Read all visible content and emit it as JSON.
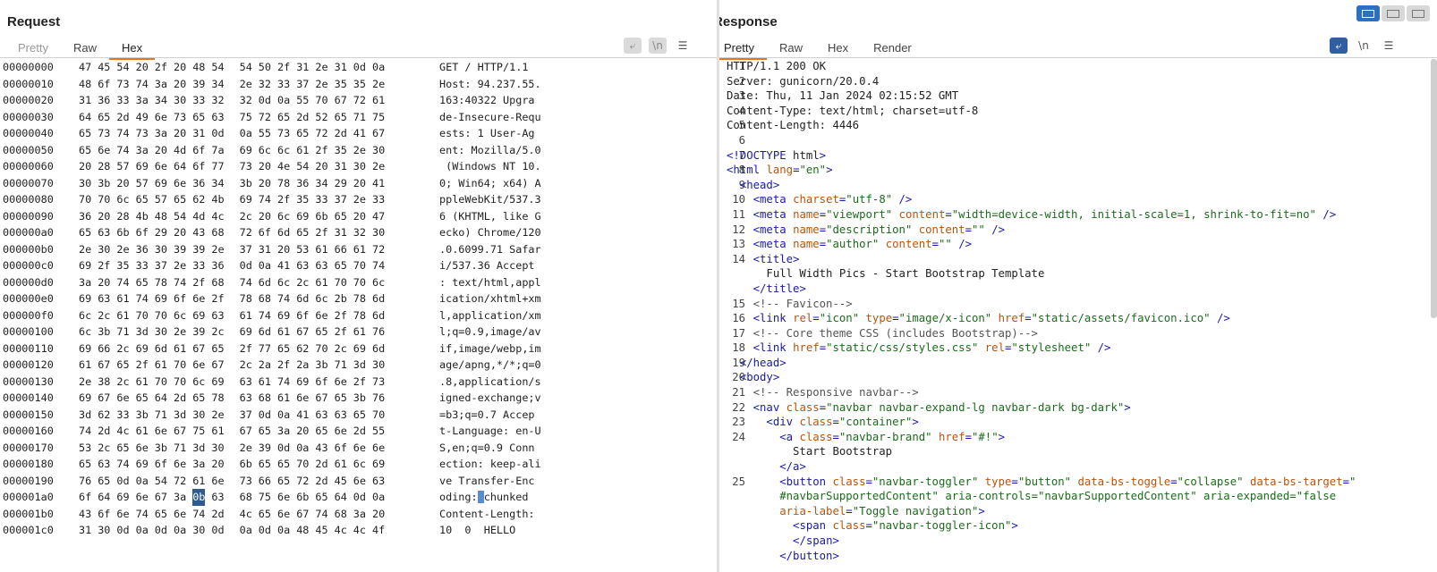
{
  "request": {
    "title": "Request",
    "tabs": [
      "Pretty",
      "Raw",
      "Hex"
    ],
    "active_tab": "Hex",
    "tools": {
      "wrap_icon": "wrap-icon",
      "newline": "\\n",
      "menu": "☰"
    },
    "rows": [
      {
        "offset": "00000000",
        "bytes": [
          "47",
          "45",
          "54",
          "20",
          "2f",
          "20",
          "48",
          "54",
          "54",
          "50",
          "2f",
          "31",
          "2e",
          "31",
          "0d",
          "0a"
        ],
        "ascii": "GET / HTTP/1.1"
      },
      {
        "offset": "00000010",
        "bytes": [
          "48",
          "6f",
          "73",
          "74",
          "3a",
          "20",
          "39",
          "34",
          "2e",
          "32",
          "33",
          "37",
          "2e",
          "35",
          "35",
          "2e"
        ],
        "ascii": "Host: 94.237.55."
      },
      {
        "offset": "00000020",
        "bytes": [
          "31",
          "36",
          "33",
          "3a",
          "34",
          "30",
          "33",
          "32",
          "32",
          "0d",
          "0a",
          "55",
          "70",
          "67",
          "72",
          "61"
        ],
        "ascii": "163:40322 Upgra"
      },
      {
        "offset": "00000030",
        "bytes": [
          "64",
          "65",
          "2d",
          "49",
          "6e",
          "73",
          "65",
          "63",
          "75",
          "72",
          "65",
          "2d",
          "52",
          "65",
          "71",
          "75"
        ],
        "ascii": "de-Insecure-Requ"
      },
      {
        "offset": "00000040",
        "bytes": [
          "65",
          "73",
          "74",
          "73",
          "3a",
          "20",
          "31",
          "0d",
          "0a",
          "55",
          "73",
          "65",
          "72",
          "2d",
          "41",
          "67"
        ],
        "ascii": "ests: 1 User-Ag"
      },
      {
        "offset": "00000050",
        "bytes": [
          "65",
          "6e",
          "74",
          "3a",
          "20",
          "4d",
          "6f",
          "7a",
          "69",
          "6c",
          "6c",
          "61",
          "2f",
          "35",
          "2e",
          "30"
        ],
        "ascii": "ent: Mozilla/5.0"
      },
      {
        "offset": "00000060",
        "bytes": [
          "20",
          "28",
          "57",
          "69",
          "6e",
          "64",
          "6f",
          "77",
          "73",
          "20",
          "4e",
          "54",
          "20",
          "31",
          "30",
          "2e"
        ],
        "ascii": " (Windows NT 10."
      },
      {
        "offset": "00000070",
        "bytes": [
          "30",
          "3b",
          "20",
          "57",
          "69",
          "6e",
          "36",
          "34",
          "3b",
          "20",
          "78",
          "36",
          "34",
          "29",
          "20",
          "41"
        ],
        "ascii": "0; Win64; x64) A"
      },
      {
        "offset": "00000080",
        "bytes": [
          "70",
          "70",
          "6c",
          "65",
          "57",
          "65",
          "62",
          "4b",
          "69",
          "74",
          "2f",
          "35",
          "33",
          "37",
          "2e",
          "33"
        ],
        "ascii": "ppleWebKit/537.3"
      },
      {
        "offset": "00000090",
        "bytes": [
          "36",
          "20",
          "28",
          "4b",
          "48",
          "54",
          "4d",
          "4c",
          "2c",
          "20",
          "6c",
          "69",
          "6b",
          "65",
          "20",
          "47"
        ],
        "ascii": "6 (KHTML, like G"
      },
      {
        "offset": "000000a0",
        "bytes": [
          "65",
          "63",
          "6b",
          "6f",
          "29",
          "20",
          "43",
          "68",
          "72",
          "6f",
          "6d",
          "65",
          "2f",
          "31",
          "32",
          "30"
        ],
        "ascii": "ecko) Chrome/120"
      },
      {
        "offset": "000000b0",
        "bytes": [
          "2e",
          "30",
          "2e",
          "36",
          "30",
          "39",
          "39",
          "2e",
          "37",
          "31",
          "20",
          "53",
          "61",
          "66",
          "61",
          "72"
        ],
        "ascii": ".0.6099.71 Safar"
      },
      {
        "offset": "000000c0",
        "bytes": [
          "69",
          "2f",
          "35",
          "33",
          "37",
          "2e",
          "33",
          "36",
          "0d",
          "0a",
          "41",
          "63",
          "63",
          "65",
          "70",
          "74"
        ],
        "ascii": "i/537.36 Accept"
      },
      {
        "offset": "000000d0",
        "bytes": [
          "3a",
          "20",
          "74",
          "65",
          "78",
          "74",
          "2f",
          "68",
          "74",
          "6d",
          "6c",
          "2c",
          "61",
          "70",
          "70",
          "6c"
        ],
        "ascii": ": text/html,appl"
      },
      {
        "offset": "000000e0",
        "bytes": [
          "69",
          "63",
          "61",
          "74",
          "69",
          "6f",
          "6e",
          "2f",
          "78",
          "68",
          "74",
          "6d",
          "6c",
          "2b",
          "78",
          "6d"
        ],
        "ascii": "ication/xhtml+xm"
      },
      {
        "offset": "000000f0",
        "bytes": [
          "6c",
          "2c",
          "61",
          "70",
          "70",
          "6c",
          "69",
          "63",
          "61",
          "74",
          "69",
          "6f",
          "6e",
          "2f",
          "78",
          "6d"
        ],
        "ascii": "l,application/xm"
      },
      {
        "offset": "00000100",
        "bytes": [
          "6c",
          "3b",
          "71",
          "3d",
          "30",
          "2e",
          "39",
          "2c",
          "69",
          "6d",
          "61",
          "67",
          "65",
          "2f",
          "61",
          "76"
        ],
        "ascii": "l;q=0.9,image/av"
      },
      {
        "offset": "00000110",
        "bytes": [
          "69",
          "66",
          "2c",
          "69",
          "6d",
          "61",
          "67",
          "65",
          "2f",
          "77",
          "65",
          "62",
          "70",
          "2c",
          "69",
          "6d"
        ],
        "ascii": "if,image/webp,im"
      },
      {
        "offset": "00000120",
        "bytes": [
          "61",
          "67",
          "65",
          "2f",
          "61",
          "70",
          "6e",
          "67",
          "2c",
          "2a",
          "2f",
          "2a",
          "3b",
          "71",
          "3d",
          "30"
        ],
        "ascii": "age/apng,*/*;q=0"
      },
      {
        "offset": "00000130",
        "bytes": [
          "2e",
          "38",
          "2c",
          "61",
          "70",
          "70",
          "6c",
          "69",
          "63",
          "61",
          "74",
          "69",
          "6f",
          "6e",
          "2f",
          "73"
        ],
        "ascii": ".8,application/s"
      },
      {
        "offset": "00000140",
        "bytes": [
          "69",
          "67",
          "6e",
          "65",
          "64",
          "2d",
          "65",
          "78",
          "63",
          "68",
          "61",
          "6e",
          "67",
          "65",
          "3b",
          "76"
        ],
        "ascii": "igned-exchange;v"
      },
      {
        "offset": "00000150",
        "bytes": [
          "3d",
          "62",
          "33",
          "3b",
          "71",
          "3d",
          "30",
          "2e",
          "37",
          "0d",
          "0a",
          "41",
          "63",
          "63",
          "65",
          "70"
        ],
        "ascii": "=b3;q=0.7 Accep"
      },
      {
        "offset": "00000160",
        "bytes": [
          "74",
          "2d",
          "4c",
          "61",
          "6e",
          "67",
          "75",
          "61",
          "67",
          "65",
          "3a",
          "20",
          "65",
          "6e",
          "2d",
          "55"
        ],
        "ascii": "t-Language: en-U"
      },
      {
        "offset": "00000170",
        "bytes": [
          "53",
          "2c",
          "65",
          "6e",
          "3b",
          "71",
          "3d",
          "30",
          "2e",
          "39",
          "0d",
          "0a",
          "43",
          "6f",
          "6e",
          "6e"
        ],
        "ascii": "S,en;q=0.9 Conn"
      },
      {
        "offset": "00000180",
        "bytes": [
          "65",
          "63",
          "74",
          "69",
          "6f",
          "6e",
          "3a",
          "20",
          "6b",
          "65",
          "65",
          "70",
          "2d",
          "61",
          "6c",
          "69"
        ],
        "ascii": "ection: keep-ali"
      },
      {
        "offset": "00000190",
        "bytes": [
          "76",
          "65",
          "0d",
          "0a",
          "54",
          "72",
          "61",
          "6e",
          "73",
          "66",
          "65",
          "72",
          "2d",
          "45",
          "6e",
          "63"
        ],
        "ascii": "ve Transfer-Enc"
      },
      {
        "offset": "000001a0",
        "bytes": [
          "6f",
          "64",
          "69",
          "6e",
          "67",
          "3a",
          "0b",
          "63",
          "68",
          "75",
          "6e",
          "6b",
          "65",
          "64",
          "0d",
          "0a"
        ],
        "ascii": "oding:|chunked",
        "selected_byte": 6
      },
      {
        "offset": "000001b0",
        "bytes": [
          "43",
          "6f",
          "6e",
          "74",
          "65",
          "6e",
          "74",
          "2d",
          "4c",
          "65",
          "6e",
          "67",
          "74",
          "68",
          "3a",
          "20"
        ],
        "ascii": "Content-Length:"
      },
      {
        "offset": "000001c0",
        "bytes": [
          "31",
          "30",
          "0d",
          "0a",
          "0d",
          "0a",
          "30",
          "0d",
          "0a",
          "0d",
          "0a",
          "48",
          "45",
          "4c",
          "4c",
          "4f"
        ],
        "ascii": "10  0  HELLO"
      }
    ]
  },
  "response": {
    "title": "Response",
    "tabs": [
      "Pretty",
      "Raw",
      "Hex",
      "Render"
    ],
    "active_tab": "Pretty",
    "tools": {
      "wrap_icon": "wrap-icon",
      "newline": "\\n",
      "menu": "☰"
    },
    "lines": [
      {
        "n": "1",
        "t": "HTTP/1.1 200 OK"
      },
      {
        "n": "2",
        "t": "Server: gunicorn/20.0.4"
      },
      {
        "n": "3",
        "t": "Date: Thu, 11 Jan 2024 02:15:52 GMT"
      },
      {
        "n": "4",
        "t": "Content-Type: text/html; charset=utf-8"
      },
      {
        "n": "5",
        "t": "Content-Length: 4446"
      },
      {
        "n": "6",
        "t": ""
      },
      {
        "n": "7",
        "t": "<!DOCTYPE html>",
        "k": "tag"
      },
      {
        "n": "8",
        "t": "<html lang=\"en\">",
        "k": "tag"
      },
      {
        "n": "9",
        "t": "  <head>",
        "k": "tag"
      },
      {
        "n": "10",
        "t": "    <meta charset=\"utf-8\" />",
        "k": "tag"
      },
      {
        "n": "11",
        "t": "    <meta name=\"viewport\" content=\"width=device-width, initial-scale=1, shrink-to-fit=no\" />",
        "k": "tag"
      },
      {
        "n": "12",
        "t": "    <meta name=\"description\" content=\"\" />",
        "k": "tag"
      },
      {
        "n": "13",
        "t": "    <meta name=\"author\" content=\"\" />",
        "k": "tag"
      },
      {
        "n": "14",
        "t": "    <title>",
        "k": "tag"
      },
      {
        "n": "",
        "t": "      Full Width Pics - Start Bootstrap Template"
      },
      {
        "n": "",
        "t": "    </title>",
        "k": "tag"
      },
      {
        "n": "15",
        "t": "    <!-- Favicon-->",
        "k": "comment"
      },
      {
        "n": "16",
        "t": "    <link rel=\"icon\" type=\"image/x-icon\" href=\"static/assets/favicon.ico\" />",
        "k": "tag"
      },
      {
        "n": "17",
        "t": "    <!-- Core theme CSS (includes Bootstrap)-->",
        "k": "comment"
      },
      {
        "n": "18",
        "t": "    <link href=\"static/css/styles.css\" rel=\"stylesheet\" />",
        "k": "tag"
      },
      {
        "n": "19",
        "t": "  </head>",
        "k": "tag"
      },
      {
        "n": "20",
        "t": "  <body>",
        "k": "tag"
      },
      {
        "n": "21",
        "t": "    <!-- Responsive navbar-->",
        "k": "comment"
      },
      {
        "n": "22",
        "t": "    <nav class=\"navbar navbar-expand-lg navbar-dark bg-dark\">",
        "k": "tag"
      },
      {
        "n": "23",
        "t": "      <div class=\"container\">",
        "k": "tag"
      },
      {
        "n": "24",
        "t": "        <a class=\"navbar-brand\" href=\"#!\">",
        "k": "tag"
      },
      {
        "n": "",
        "t": "          Start Bootstrap"
      },
      {
        "n": "",
        "t": "        </a>",
        "k": "tag"
      },
      {
        "n": "25",
        "t": "        <button class=\"navbar-toggler\" type=\"button\" data-bs-toggle=\"collapse\" data-bs-target=\"",
        "k": "tag"
      },
      {
        "n": "",
        "t": "        #navbarSupportedContent\" aria-controls=\"navbarSupportedContent\" aria-expanded=\"false\"",
        "k": "cont"
      },
      {
        "n": "",
        "t": "        aria-label=\"Toggle navigation\">",
        "k": "cont"
      },
      {
        "n": "",
        "t": "          <span class=\"navbar-toggler-icon\">",
        "k": "tag"
      },
      {
        "n": "",
        "t": "          </span>",
        "k": "tag"
      },
      {
        "n": "",
        "t": "        </button>",
        "k": "tag"
      }
    ]
  },
  "layout_buttons": [
    "split-vertical-icon",
    "split-horizontal-icon",
    "single-pane-icon"
  ],
  "colors": {
    "accent": "#e8731a",
    "selection": "#2f5a8f",
    "toggle_on": "#2f5ea3"
  }
}
